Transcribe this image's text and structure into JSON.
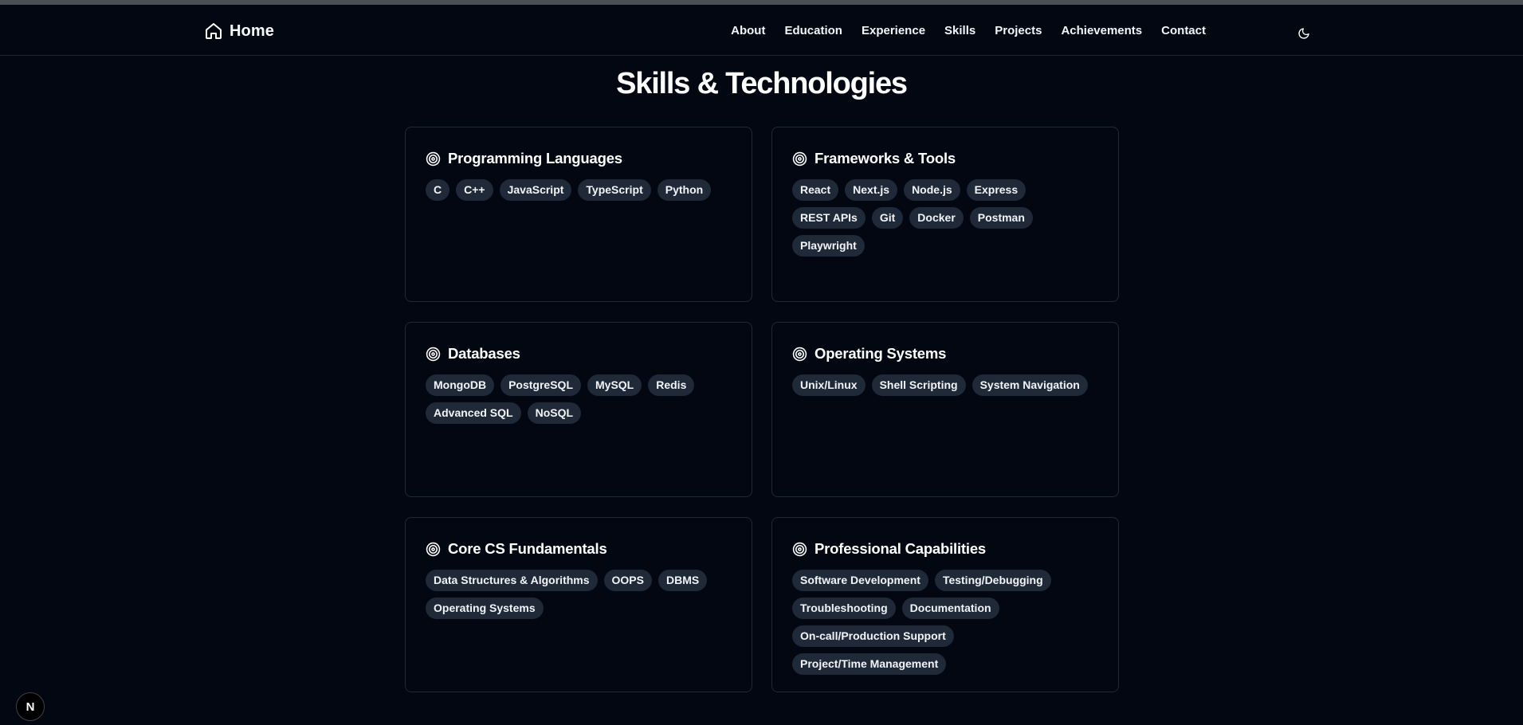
{
  "nav": {
    "brand_label": "Home",
    "links": [
      "About",
      "Education",
      "Experience",
      "Skills",
      "Projects",
      "Achievements",
      "Contact"
    ],
    "theme_icon": "moon-icon"
  },
  "page": {
    "title": "Skills & Technologies"
  },
  "cards": [
    {
      "title": "Programming Languages",
      "icon": "target-icon",
      "tags": [
        "C",
        "C++",
        "JavaScript",
        "TypeScript",
        "Python"
      ]
    },
    {
      "title": "Frameworks & Tools",
      "icon": "target-icon",
      "tags": [
        "React",
        "Next.js",
        "Node.js",
        "Express",
        "REST APIs",
        "Git",
        "Docker",
        "Postman",
        "Playwright"
      ]
    },
    {
      "title": "Databases",
      "icon": "target-icon",
      "tags": [
        "MongoDB",
        "PostgreSQL",
        "MySQL",
        "Redis",
        "Advanced SQL",
        "NoSQL"
      ]
    },
    {
      "title": "Operating Systems",
      "icon": "target-icon",
      "tags": [
        "Unix/Linux",
        "Shell Scripting",
        "System Navigation"
      ]
    },
    {
      "title": "Core CS Fundamentals",
      "icon": "target-icon",
      "tags": [
        "Data Structures & Algorithms",
        "OOPS",
        "DBMS",
        "Operating Systems"
      ]
    },
    {
      "title": "Professional Capabilities",
      "icon": "target-icon",
      "tags": [
        "Software Development",
        "Testing/Debugging",
        "Troubleshooting",
        "Documentation",
        "On-call/Production Support",
        "Project/Time Management"
      ]
    }
  ],
  "badge": {
    "letter": "N"
  },
  "colors": {
    "background": "#030712",
    "card_border": "#1f2937",
    "tag_background": "#1f2937",
    "text": "#f8fafc"
  }
}
